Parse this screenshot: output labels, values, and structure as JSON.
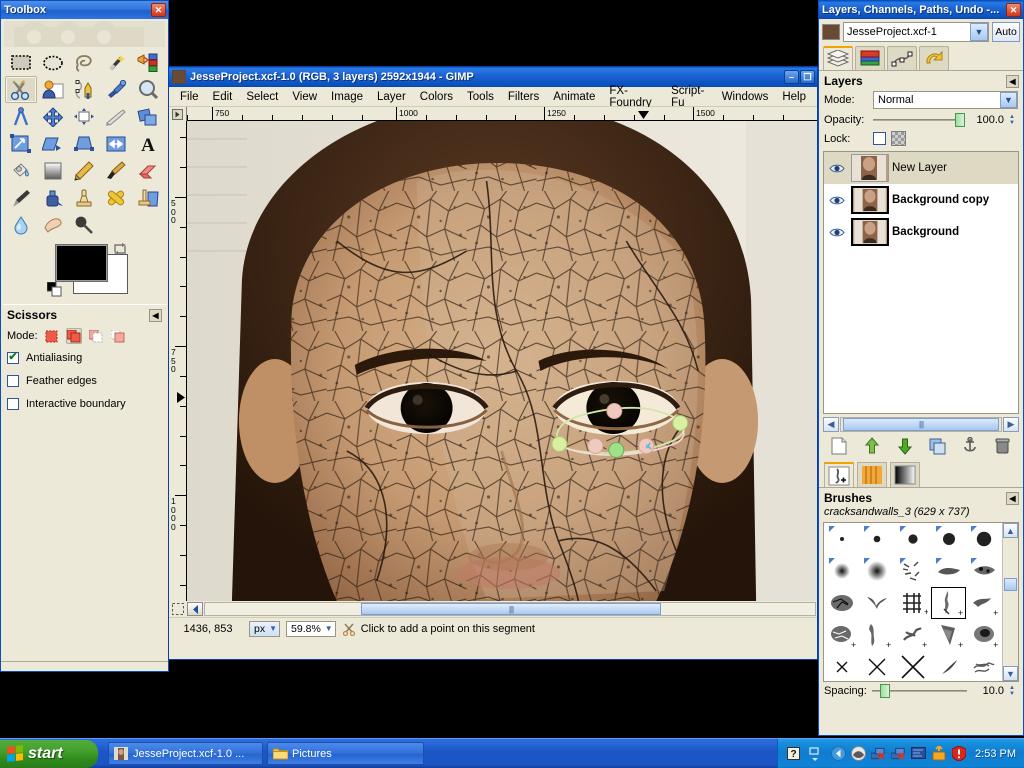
{
  "desktop": {
    "background_color": "#000000"
  },
  "toolbox": {
    "title": "Toolbox",
    "close_label": "✕",
    "tools": [
      {
        "name": "rect-select-tool",
        "label": "Rectangle Select"
      },
      {
        "name": "ellipse-select-tool",
        "label": "Ellipse Select"
      },
      {
        "name": "free-select-tool",
        "label": "Free Select (Lasso)"
      },
      {
        "name": "fuzzy-select-tool",
        "label": "Fuzzy Select (Magic Wand)"
      },
      {
        "name": "select-by-color-tool",
        "label": "Select By Color"
      },
      {
        "name": "scissors-select-tool",
        "label": "Intelligent Scissors"
      },
      {
        "name": "foreground-select-tool",
        "label": "Foreground Select"
      },
      {
        "name": "paths-tool",
        "label": "Paths"
      },
      {
        "name": "color-picker-tool",
        "label": "Color Picker"
      },
      {
        "name": "zoom-tool",
        "label": "Zoom"
      },
      {
        "name": "measure-tool",
        "label": "Measure"
      },
      {
        "name": "move-tool",
        "label": "Move"
      },
      {
        "name": "align-tool",
        "label": "Alignment"
      },
      {
        "name": "crop-tool",
        "label": "Crop"
      },
      {
        "name": "rotate-tool",
        "label": "Rotate"
      },
      {
        "name": "scale-tool",
        "label": "Scale"
      },
      {
        "name": "shear-tool",
        "label": "Shear"
      },
      {
        "name": "perspective-tool",
        "label": "Perspective"
      },
      {
        "name": "flip-tool",
        "label": "Flip"
      },
      {
        "name": "text-tool",
        "label": "Text"
      },
      {
        "name": "bucket-fill-tool",
        "label": "Bucket Fill"
      },
      {
        "name": "gradient-tool",
        "label": "Blend / Gradient"
      },
      {
        "name": "pencil-tool",
        "label": "Pencil"
      },
      {
        "name": "paintbrush-tool",
        "label": "Paintbrush"
      },
      {
        "name": "eraser-tool",
        "label": "Eraser"
      },
      {
        "name": "airbrush-tool",
        "label": "Airbrush"
      },
      {
        "name": "ink-tool",
        "label": "Ink"
      },
      {
        "name": "clone-tool",
        "label": "Clone"
      },
      {
        "name": "heal-tool",
        "label": "Heal"
      },
      {
        "name": "perspective-clone-tool",
        "label": "Perspective Clone"
      },
      {
        "name": "blur-sharpen-tool",
        "label": "Blur / Sharpen"
      },
      {
        "name": "smudge-tool",
        "label": "Smudge"
      },
      {
        "name": "dodge-burn-tool",
        "label": "Dodge / Burn"
      }
    ],
    "active_tool_index": 5,
    "colors": {
      "foreground": "#000000",
      "background": "#ffffff"
    }
  },
  "tool_options": {
    "title": "Scissors",
    "collapse_label": "◀",
    "mode_label": "Mode:",
    "modes": [
      "replace",
      "add",
      "subtract",
      "intersect"
    ],
    "active_mode_index": 1,
    "checkboxes": [
      {
        "label": "Antialiasing",
        "checked": true,
        "mark": "✔"
      },
      {
        "label": "Feather edges",
        "checked": false,
        "mark": ""
      },
      {
        "label": "Interactive boundary",
        "checked": false,
        "mark": ""
      }
    ]
  },
  "gimp_window": {
    "title": "JesseProject.xcf-1.0 (RGB, 3 layers) 2592x1944 - GIMP",
    "minimize_label": "–",
    "restore_label": "❐",
    "menus": [
      {
        "label": "File",
        "accel": "F"
      },
      {
        "label": "Edit",
        "accel": "E"
      },
      {
        "label": "Select",
        "accel": "S"
      },
      {
        "label": "View",
        "accel": "V"
      },
      {
        "label": "Image",
        "accel": "I"
      },
      {
        "label": "Layer",
        "accel": "L"
      },
      {
        "label": "Colors",
        "accel": "C"
      },
      {
        "label": "Tools",
        "accel": "T"
      },
      {
        "label": "Filters",
        "accel": "R"
      },
      {
        "label": "Animate",
        "accel": "A"
      },
      {
        "label": "FX-Foundry",
        "accel": "X"
      },
      {
        "label": "Script-Fu",
        "accel": "S"
      },
      {
        "label": "Windows",
        "accel": "W"
      },
      {
        "label": "Help",
        "accel": "H"
      }
    ],
    "ruler_h_labels": [
      "750",
      "1000",
      "1250",
      "1500"
    ],
    "ruler_v_labels": [
      "500",
      "750",
      "1000"
    ],
    "statusbar": {
      "position": "1436, 853",
      "unit": "px",
      "zoom": "59.8%",
      "message": "Click to add a point on this segment"
    }
  },
  "dock": {
    "title": "Layers, Channels, Paths, Undo -...",
    "close_label": "✕",
    "image_name": "JesseProject.xcf-1",
    "auto_label": "Auto",
    "tabs": [
      {
        "name": "layers-tab",
        "label": "Layers"
      },
      {
        "name": "channels-tab",
        "label": "Channels"
      },
      {
        "name": "paths-tab",
        "label": "Paths"
      },
      {
        "name": "undo-history-tab",
        "label": "Undo History"
      }
    ],
    "active_tab_index": 0,
    "layers_panel": {
      "title": "Layers",
      "collapse_label": "◀",
      "mode_label": "Mode:",
      "mode_value": "Normal",
      "opacity_label": "Opacity:",
      "opacity_value": "100.0",
      "lock_label": "Lock:",
      "layers": [
        {
          "name": "New Layer",
          "visible": true,
          "selected": true
        },
        {
          "name": "Background copy",
          "visible": true,
          "selected": false
        },
        {
          "name": "Background",
          "visible": true,
          "selected": false
        }
      ],
      "buttons": [
        {
          "name": "new-layer-button",
          "label": "New Layer"
        },
        {
          "name": "raise-layer-button",
          "label": "Raise Layer"
        },
        {
          "name": "lower-layer-button",
          "label": "Lower Layer"
        },
        {
          "name": "duplicate-layer-button",
          "label": "Duplicate Layer"
        },
        {
          "name": "anchor-layer-button",
          "label": "Anchor Layer"
        },
        {
          "name": "delete-layer-button",
          "label": "Delete Layer"
        }
      ]
    },
    "brushes_panel": {
      "tabs": [
        {
          "name": "brushes-tab",
          "label": "Brushes"
        },
        {
          "name": "patterns-tab",
          "label": "Patterns"
        },
        {
          "name": "gradients-tab",
          "label": "Gradients"
        }
      ],
      "active_tab_index": 0,
      "title": "Brushes",
      "collapse_label": "◀",
      "selected_brush": "cracksandwalls_3 (629 x 737)",
      "spacing_label": "Spacing:",
      "spacing_value": "10.0",
      "selected_cell_index": 13
    }
  },
  "taskbar": {
    "start_label": "start",
    "buttons": [
      {
        "name": "taskbar-button-gimp",
        "label": "JesseProject.xcf-1.0 ..."
      },
      {
        "name": "taskbar-button-pictures",
        "label": "Pictures"
      }
    ],
    "tray_icons": [
      {
        "name": "help-tray-icon"
      },
      {
        "name": "show-hidden-icons-icon"
      },
      {
        "name": "back-arrow-tray-icon"
      },
      {
        "name": "media-tray-icon"
      },
      {
        "name": "network-disconnected-tray-icon"
      },
      {
        "name": "network-disconnected-2-tray-icon"
      },
      {
        "name": "display-tray-icon"
      },
      {
        "name": "update-tray-icon"
      },
      {
        "name": "security-alert-tray-icon"
      }
    ],
    "clock": "2:53 PM"
  }
}
